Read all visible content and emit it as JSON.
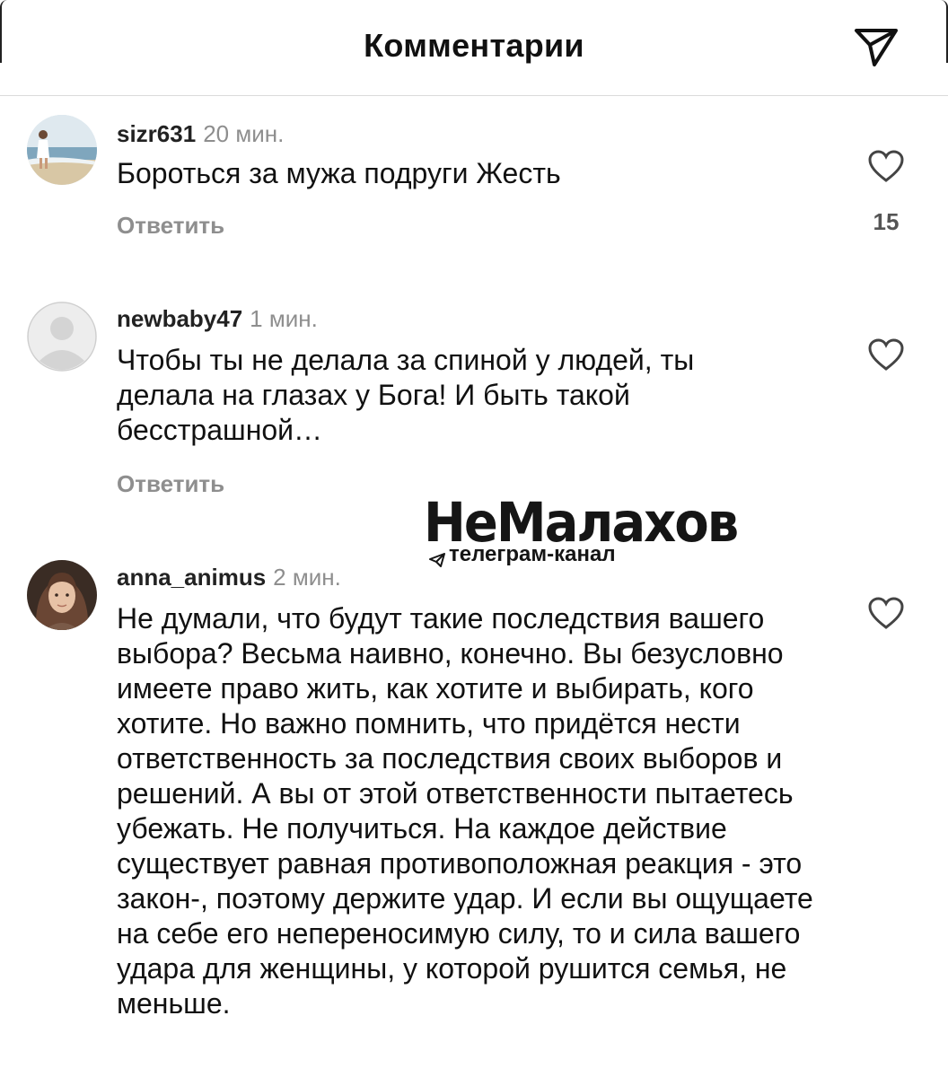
{
  "header": {
    "title": "Комментарии",
    "share_icon": "paper-plane-icon"
  },
  "comments": [
    {
      "username": "sizr631",
      "time": "20 мин.",
      "text": "Бороться за мужа подруги Жесть",
      "reply_label": "Ответить",
      "likes": "15",
      "avatar": "beach-photo-avatar"
    },
    {
      "username": "newbaby47",
      "time": "1 мин.",
      "text": "Чтобы ты не делала за спиной у людей, ты делала на глазах у Бога! И быть такой бесстрашной…",
      "reply_label": "Ответить",
      "likes": "",
      "avatar": "default-user-avatar"
    },
    {
      "username": "anna_animus",
      "time": "2 мин.",
      "text": "Не думали, что будут такие последствия вашего выбора? Весьма наивно, конечно. Вы безусловно имеете право жить, как хотите и выбирать, кого хотите. Но важно помнить, что придётся нести ответственность за последствия своих выборов и решений. А вы от этой ответственности пытаетесь убежать. Не получиться. На каждое действие существует равная противоположная реакция - это закон-, поэтому держите удар. И если вы ощущаете на себе его непереносимую силу, то и сила вашего удара для женщины, у которой рушится семья, не меньше.",
      "avatar": "woman-portrait-avatar"
    }
  ],
  "watermark": {
    "title": "НеМалахов",
    "subtitle": "телеграм-канал"
  },
  "colors": {
    "muted": "#8e8e8e",
    "text": "#111111",
    "divider": "#dbdbdb"
  }
}
